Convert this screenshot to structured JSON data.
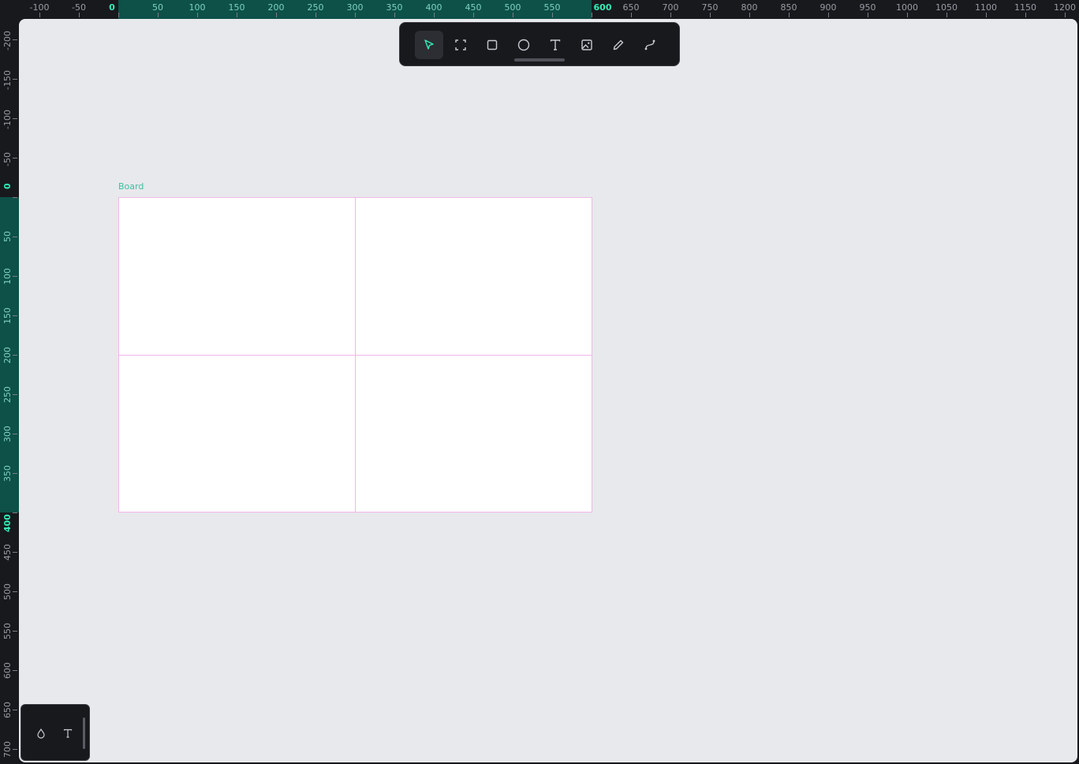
{
  "ruler_top": {
    "labels": [
      "-100",
      "-50",
      "0",
      "50",
      "100",
      "150",
      "200",
      "250",
      "300",
      "350",
      "400",
      "450",
      "500",
      "550",
      "600",
      "650",
      "700",
      "750",
      "800",
      "850",
      "900",
      "950",
      "1000",
      "1050",
      "1100",
      "1150",
      "1200"
    ]
  },
  "ruler_left": {
    "labels": [
      "-200",
      "-150",
      "-100",
      "-50",
      "0",
      "50",
      "100",
      "150",
      "200",
      "250",
      "300",
      "350",
      "400",
      "450",
      "500",
      "550",
      "600",
      "650",
      "700"
    ]
  },
  "board": {
    "title": "Board"
  },
  "toolbar": {
    "tools": [
      {
        "name": "select-tool",
        "icon": "cursor-icon",
        "active": true
      },
      {
        "name": "board-tool",
        "icon": "board-frame-icon",
        "active": false
      },
      {
        "name": "rectangle-tool",
        "icon": "rectangle-icon",
        "active": false
      },
      {
        "name": "ellipse-tool",
        "icon": "ellipse-icon",
        "active": false
      },
      {
        "name": "text-tool",
        "icon": "text-icon",
        "active": false
      },
      {
        "name": "image-tool",
        "icon": "image-icon",
        "active": false
      },
      {
        "name": "pencil-tool",
        "icon": "pencil-icon",
        "active": false
      },
      {
        "name": "path-tool",
        "icon": "path-icon",
        "active": false
      }
    ]
  },
  "palette": {
    "items": [
      {
        "name": "color-palette-button",
        "icon": "drop-icon"
      },
      {
        "name": "typography-button",
        "icon": "text-icon"
      }
    ]
  },
  "colors": {
    "accent": "#31efb8",
    "ruler_selection": "#0d5149",
    "board_guides": "#f0b7ea",
    "canvas_bg": "#e8e9ec",
    "chrome_bg": "#18191d"
  }
}
